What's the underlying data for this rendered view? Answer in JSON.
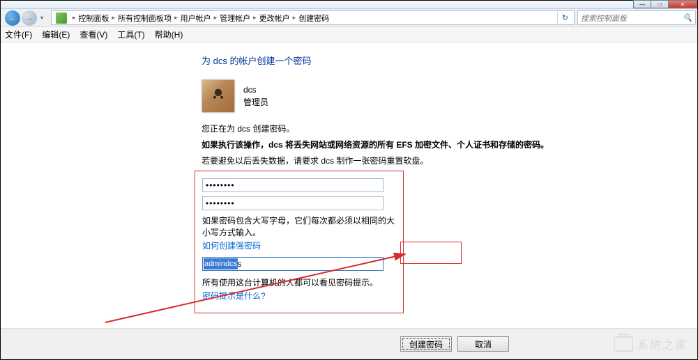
{
  "window_controls": {
    "min": "—",
    "max": "□",
    "close": "✕"
  },
  "nav": {
    "back": "←",
    "fwd": "→",
    "drop": "▾"
  },
  "breadcrumb": {
    "sep": "▸",
    "items": [
      "控制面板",
      "所有控制面板项",
      "用户帐户",
      "管理帐户",
      "更改帐户",
      "创建密码"
    ]
  },
  "addr_refresh": "↻",
  "search": {
    "placeholder": "搜索控制面板",
    "icon": "🔍"
  },
  "menu": {
    "file": "文件(F)",
    "edit": "编辑(E)",
    "view": "查看(V)",
    "tools": "工具(T)",
    "help": "帮助(H)"
  },
  "page": {
    "title": "为 dcs 的帐户创建一个密码",
    "user_name": "dcs",
    "user_role": "管理员",
    "creating_for": "您正在为 dcs 创建密码。",
    "warning": "如果执行该操作，dcs 将丢失网站或网络资源的所有 EFS 加密文件、个人证书和存储的密码。",
    "advice": "若要避免以后丢失数据，请要求 dcs 制作一张密码重置软盘。",
    "pw1_value": "••••••••",
    "pw2_value": "••••••••",
    "case_note": "如果密码包含大写字母，它们每次都必须以相同的大小写方式输入。",
    "link_strong": "如何创建强密码",
    "hint_value": "admindcs",
    "hint_visible_note": "所有使用这台计算机的人都可以看见密码提示。",
    "link_hint": "密码提示是什么?"
  },
  "footer": {
    "create": "创建密码",
    "cancel": "取消"
  },
  "watermark": "系统之家"
}
